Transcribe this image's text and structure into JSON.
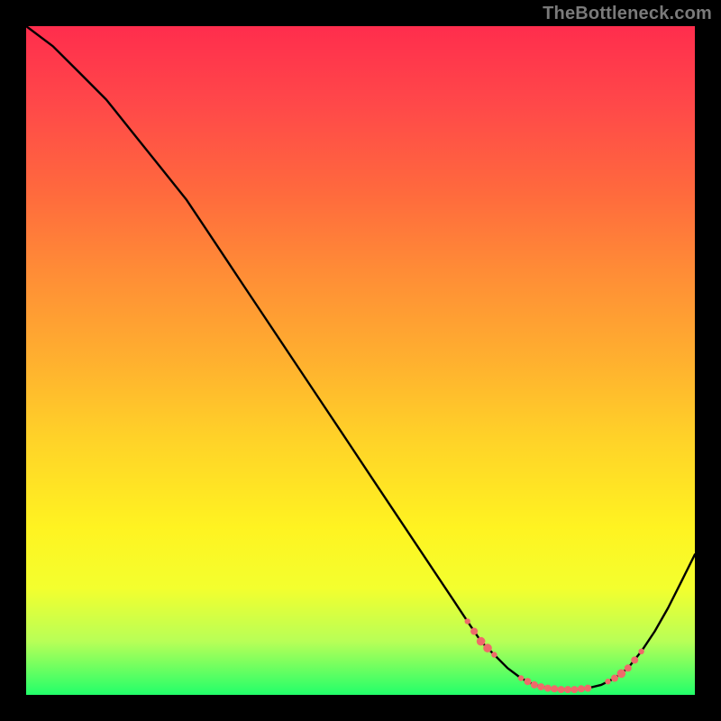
{
  "watermark": "TheBottleneck.com",
  "chart_data": {
    "type": "line",
    "title": "",
    "xlabel": "",
    "ylabel": "",
    "xlim": [
      0,
      100
    ],
    "ylim": [
      0,
      100
    ],
    "series": [
      {
        "name": "curve",
        "x": [
          0,
          4,
          8,
          12,
          16,
          20,
          24,
          28,
          32,
          36,
          40,
          44,
          48,
          52,
          56,
          60,
          64,
          66,
          68,
          70,
          72,
          74,
          76,
          78,
          80,
          82,
          84,
          86,
          88,
          90,
          92,
          94,
          96,
          98,
          100
        ],
        "y": [
          100,
          97,
          93,
          89,
          84,
          79,
          74,
          68,
          62,
          56,
          50,
          44,
          38,
          32,
          26,
          20,
          14,
          11,
          8,
          6,
          4,
          2.5,
          1.5,
          1,
          0.8,
          0.8,
          1,
          1.5,
          2.5,
          4,
          6.5,
          9.5,
          13,
          17,
          21
        ]
      }
    ],
    "markers": {
      "name": "highlight-points",
      "color": "#ef6a6a",
      "points": [
        {
          "x": 66,
          "y": 11,
          "r": 2.0
        },
        {
          "x": 67,
          "y": 9.5,
          "r": 2.5
        },
        {
          "x": 68,
          "y": 8,
          "r": 3.0
        },
        {
          "x": 69,
          "y": 7,
          "r": 3.0
        },
        {
          "x": 70,
          "y": 6,
          "r": 2.0
        },
        {
          "x": 74,
          "y": 2.5,
          "r": 2.0
        },
        {
          "x": 75,
          "y": 2.0,
          "r": 2.5
        },
        {
          "x": 76,
          "y": 1.5,
          "r": 2.5
        },
        {
          "x": 77,
          "y": 1.2,
          "r": 2.5
        },
        {
          "x": 78,
          "y": 1.0,
          "r": 2.5
        },
        {
          "x": 79,
          "y": 0.9,
          "r": 2.5
        },
        {
          "x": 80,
          "y": 0.8,
          "r": 2.5
        },
        {
          "x": 81,
          "y": 0.8,
          "r": 2.5
        },
        {
          "x": 82,
          "y": 0.8,
          "r": 2.5
        },
        {
          "x": 83,
          "y": 0.9,
          "r": 2.5
        },
        {
          "x": 84,
          "y": 1.0,
          "r": 2.5
        },
        {
          "x": 87,
          "y": 2.0,
          "r": 2.0
        },
        {
          "x": 88,
          "y": 2.5,
          "r": 2.5
        },
        {
          "x": 89,
          "y": 3.2,
          "r": 3.0
        },
        {
          "x": 90,
          "y": 4.0,
          "r": 2.5
        },
        {
          "x": 91,
          "y": 5.2,
          "r": 2.5
        },
        {
          "x": 92,
          "y": 6.5,
          "r": 2.0
        }
      ]
    }
  }
}
